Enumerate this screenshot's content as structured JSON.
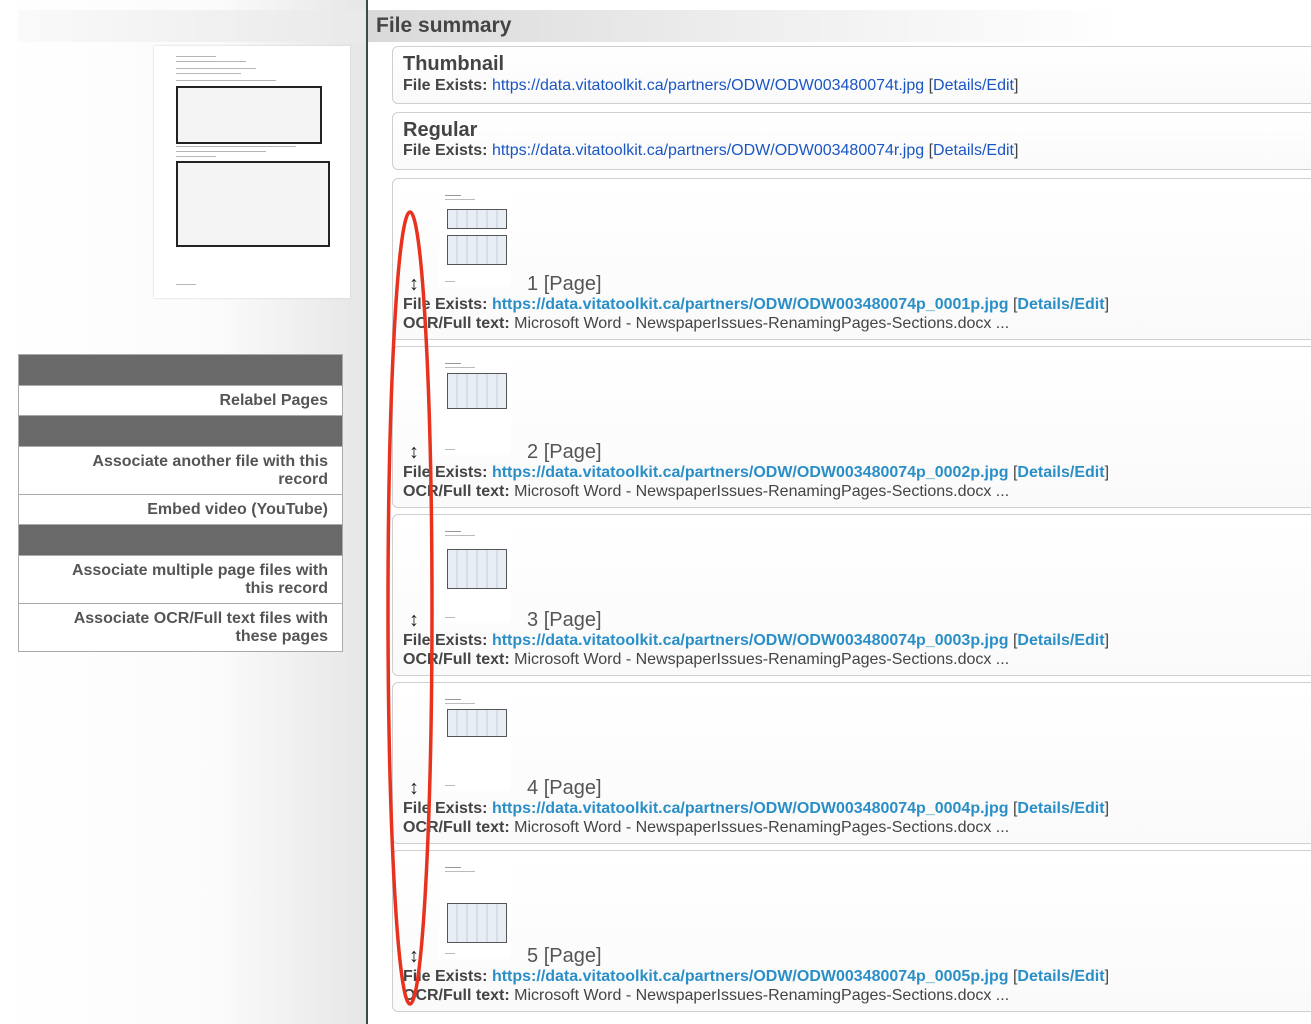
{
  "left": {
    "menu": [
      {
        "type": "header"
      },
      {
        "type": "item",
        "label": "Relabel Pages"
      },
      {
        "type": "header"
      },
      {
        "type": "item",
        "label": "Associate another file with this record"
      },
      {
        "type": "item",
        "label": "Embed video (YouTube)"
      },
      {
        "type": "header"
      },
      {
        "type": "item",
        "label": "Associate multiple page files with this record"
      },
      {
        "type": "item",
        "label": "Associate OCR/Full text files with these pages"
      }
    ]
  },
  "main": {
    "title": "File summary",
    "file_exists_label": "File Exists:",
    "details_label": "Details/Edit",
    "ocr_label": "OCR/Full text:",
    "thumbnail": {
      "title": "Thumbnail",
      "url": "https://data.vitatoolkit.ca/partners/ODW/ODW003480074t.jpg"
    },
    "regular": {
      "title": "Regular",
      "url": "https://data.vitatoolkit.ca/partners/ODW/ODW003480074r.jpg"
    },
    "drag_icon": "↕",
    "pages": [
      {
        "number": "1",
        "label": "[Page]",
        "url": "https://data.vitatoolkit.ca/partners/ODW/ODW003480074p_0001p.jpg",
        "ocr": "Microsoft Word - NewspaperIssues-RenamingPages-Sections.docx ..."
      },
      {
        "number": "2",
        "label": "[Page]",
        "url": "https://data.vitatoolkit.ca/partners/ODW/ODW003480074p_0002p.jpg",
        "ocr": "Microsoft Word - NewspaperIssues-RenamingPages-Sections.docx ..."
      },
      {
        "number": "3",
        "label": "[Page]",
        "url": "https://data.vitatoolkit.ca/partners/ODW/ODW003480074p_0003p.jpg",
        "ocr": "Microsoft Word - NewspaperIssues-RenamingPages-Sections.docx ..."
      },
      {
        "number": "4",
        "label": "[Page]",
        "url": "https://data.vitatoolkit.ca/partners/ODW/ODW003480074p_0004p.jpg",
        "ocr": "Microsoft Word - NewspaperIssues-RenamingPages-Sections.docx ..."
      },
      {
        "number": "5",
        "label": "[Page]",
        "url": "https://data.vitatoolkit.ca/partners/ODW/ODW003480074p_0005p.jpg",
        "ocr": "Microsoft Word - NewspaperIssues-RenamingPages-Sections.docx ..."
      }
    ]
  },
  "colors": {
    "link": "#1a56c4",
    "link_bold": "#2b8fc7",
    "menu_header": "#696969",
    "annotation": "#e8321e"
  }
}
